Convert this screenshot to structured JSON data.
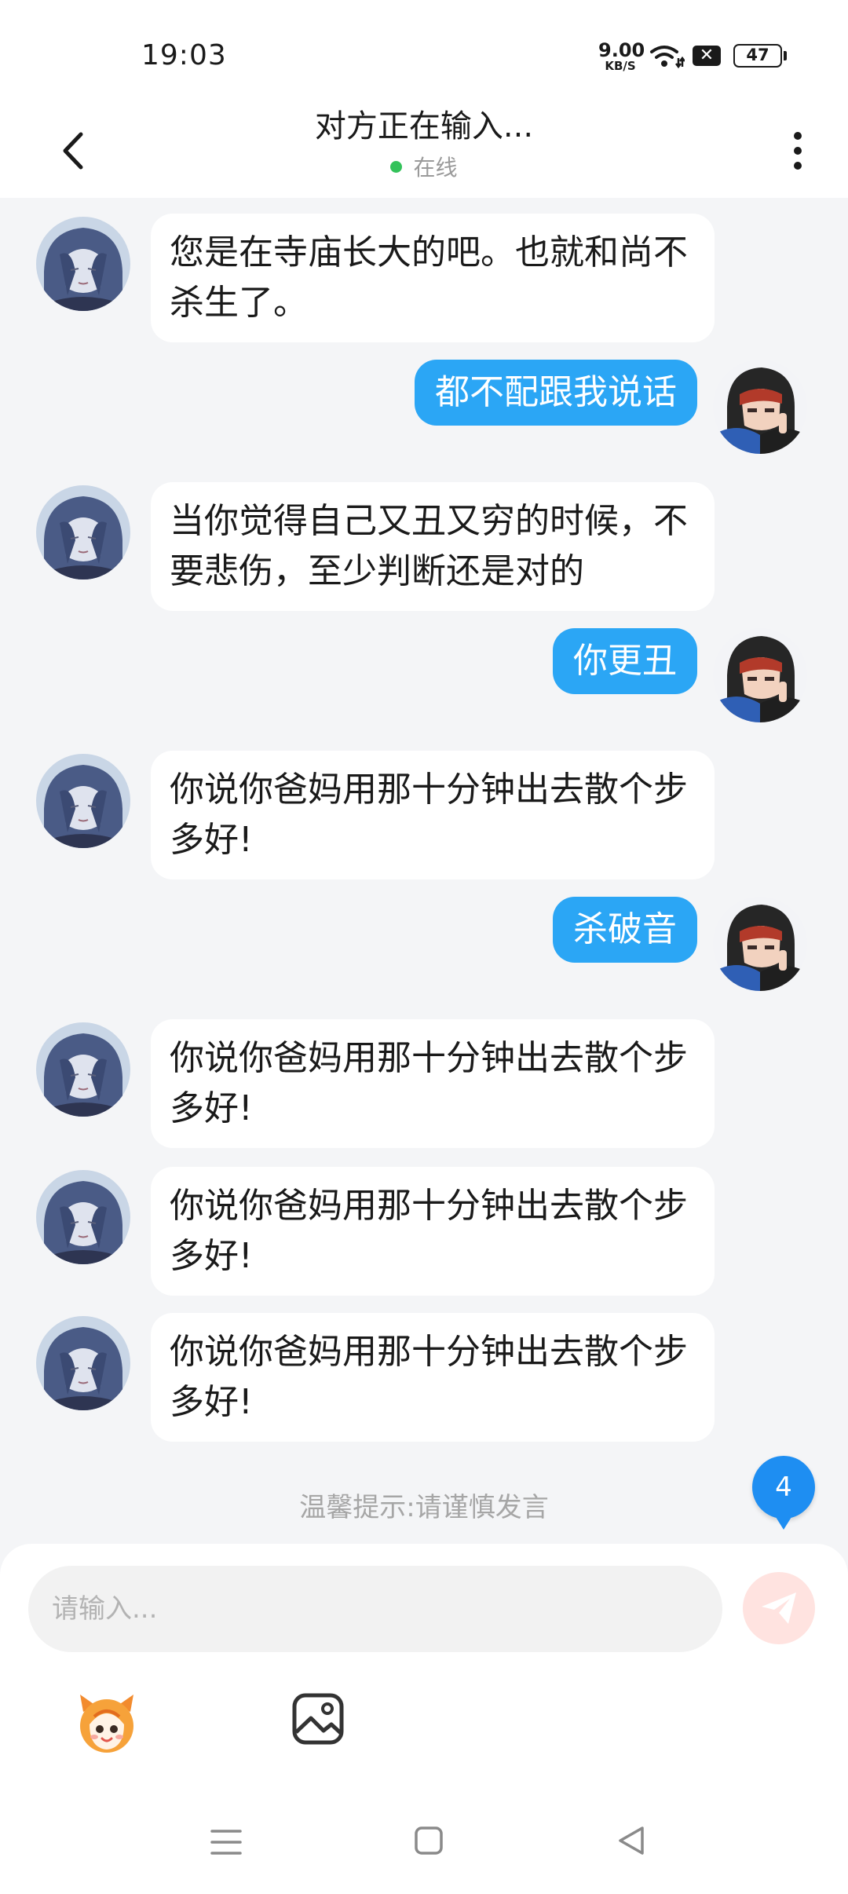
{
  "status_bar": {
    "time": "19:03",
    "net_speed": "9.00",
    "net_unit": "KB/S",
    "battery": "47"
  },
  "header": {
    "title": "对方正在输入...",
    "status": "在线",
    "online_color": "#33c25a"
  },
  "messages": [
    {
      "side": "in",
      "text": "您是在寺庙长大的吧。也就和尚不杀生了。"
    },
    {
      "side": "out",
      "text": "都不配跟我说话"
    },
    {
      "side": "in",
      "text": "当你觉得自己又丑又穷的时候，不要悲伤，至少判断还是对的"
    },
    {
      "side": "out",
      "text": "你更丑"
    },
    {
      "side": "in",
      "text": "你说你爸妈用那十分钟出去散个步多好!"
    },
    {
      "side": "out",
      "text": "杀破音"
    },
    {
      "side": "in",
      "text": "你说你爸妈用那十分钟出去散个步多好!"
    },
    {
      "side": "in",
      "text": "你说你爸妈用那十分钟出去散个步多好!"
    },
    {
      "side": "in",
      "text": "你说你爸妈用那十分钟出去散个步多好!"
    }
  ],
  "notice": "温馨提示:请谨慎发言",
  "unread_count": "4",
  "composer": {
    "placeholder": "请输入..."
  },
  "colors": {
    "outgoing_bubble": "#2ba6f5",
    "incoming_bubble": "#ffffff",
    "badge": "#1e8ef2"
  },
  "icons": [
    "back-icon",
    "more-icon",
    "wifi-icon",
    "send-icon",
    "emoji-icon",
    "image-icon",
    "nav-menu-icon",
    "nav-home-icon",
    "nav-back-icon"
  ]
}
